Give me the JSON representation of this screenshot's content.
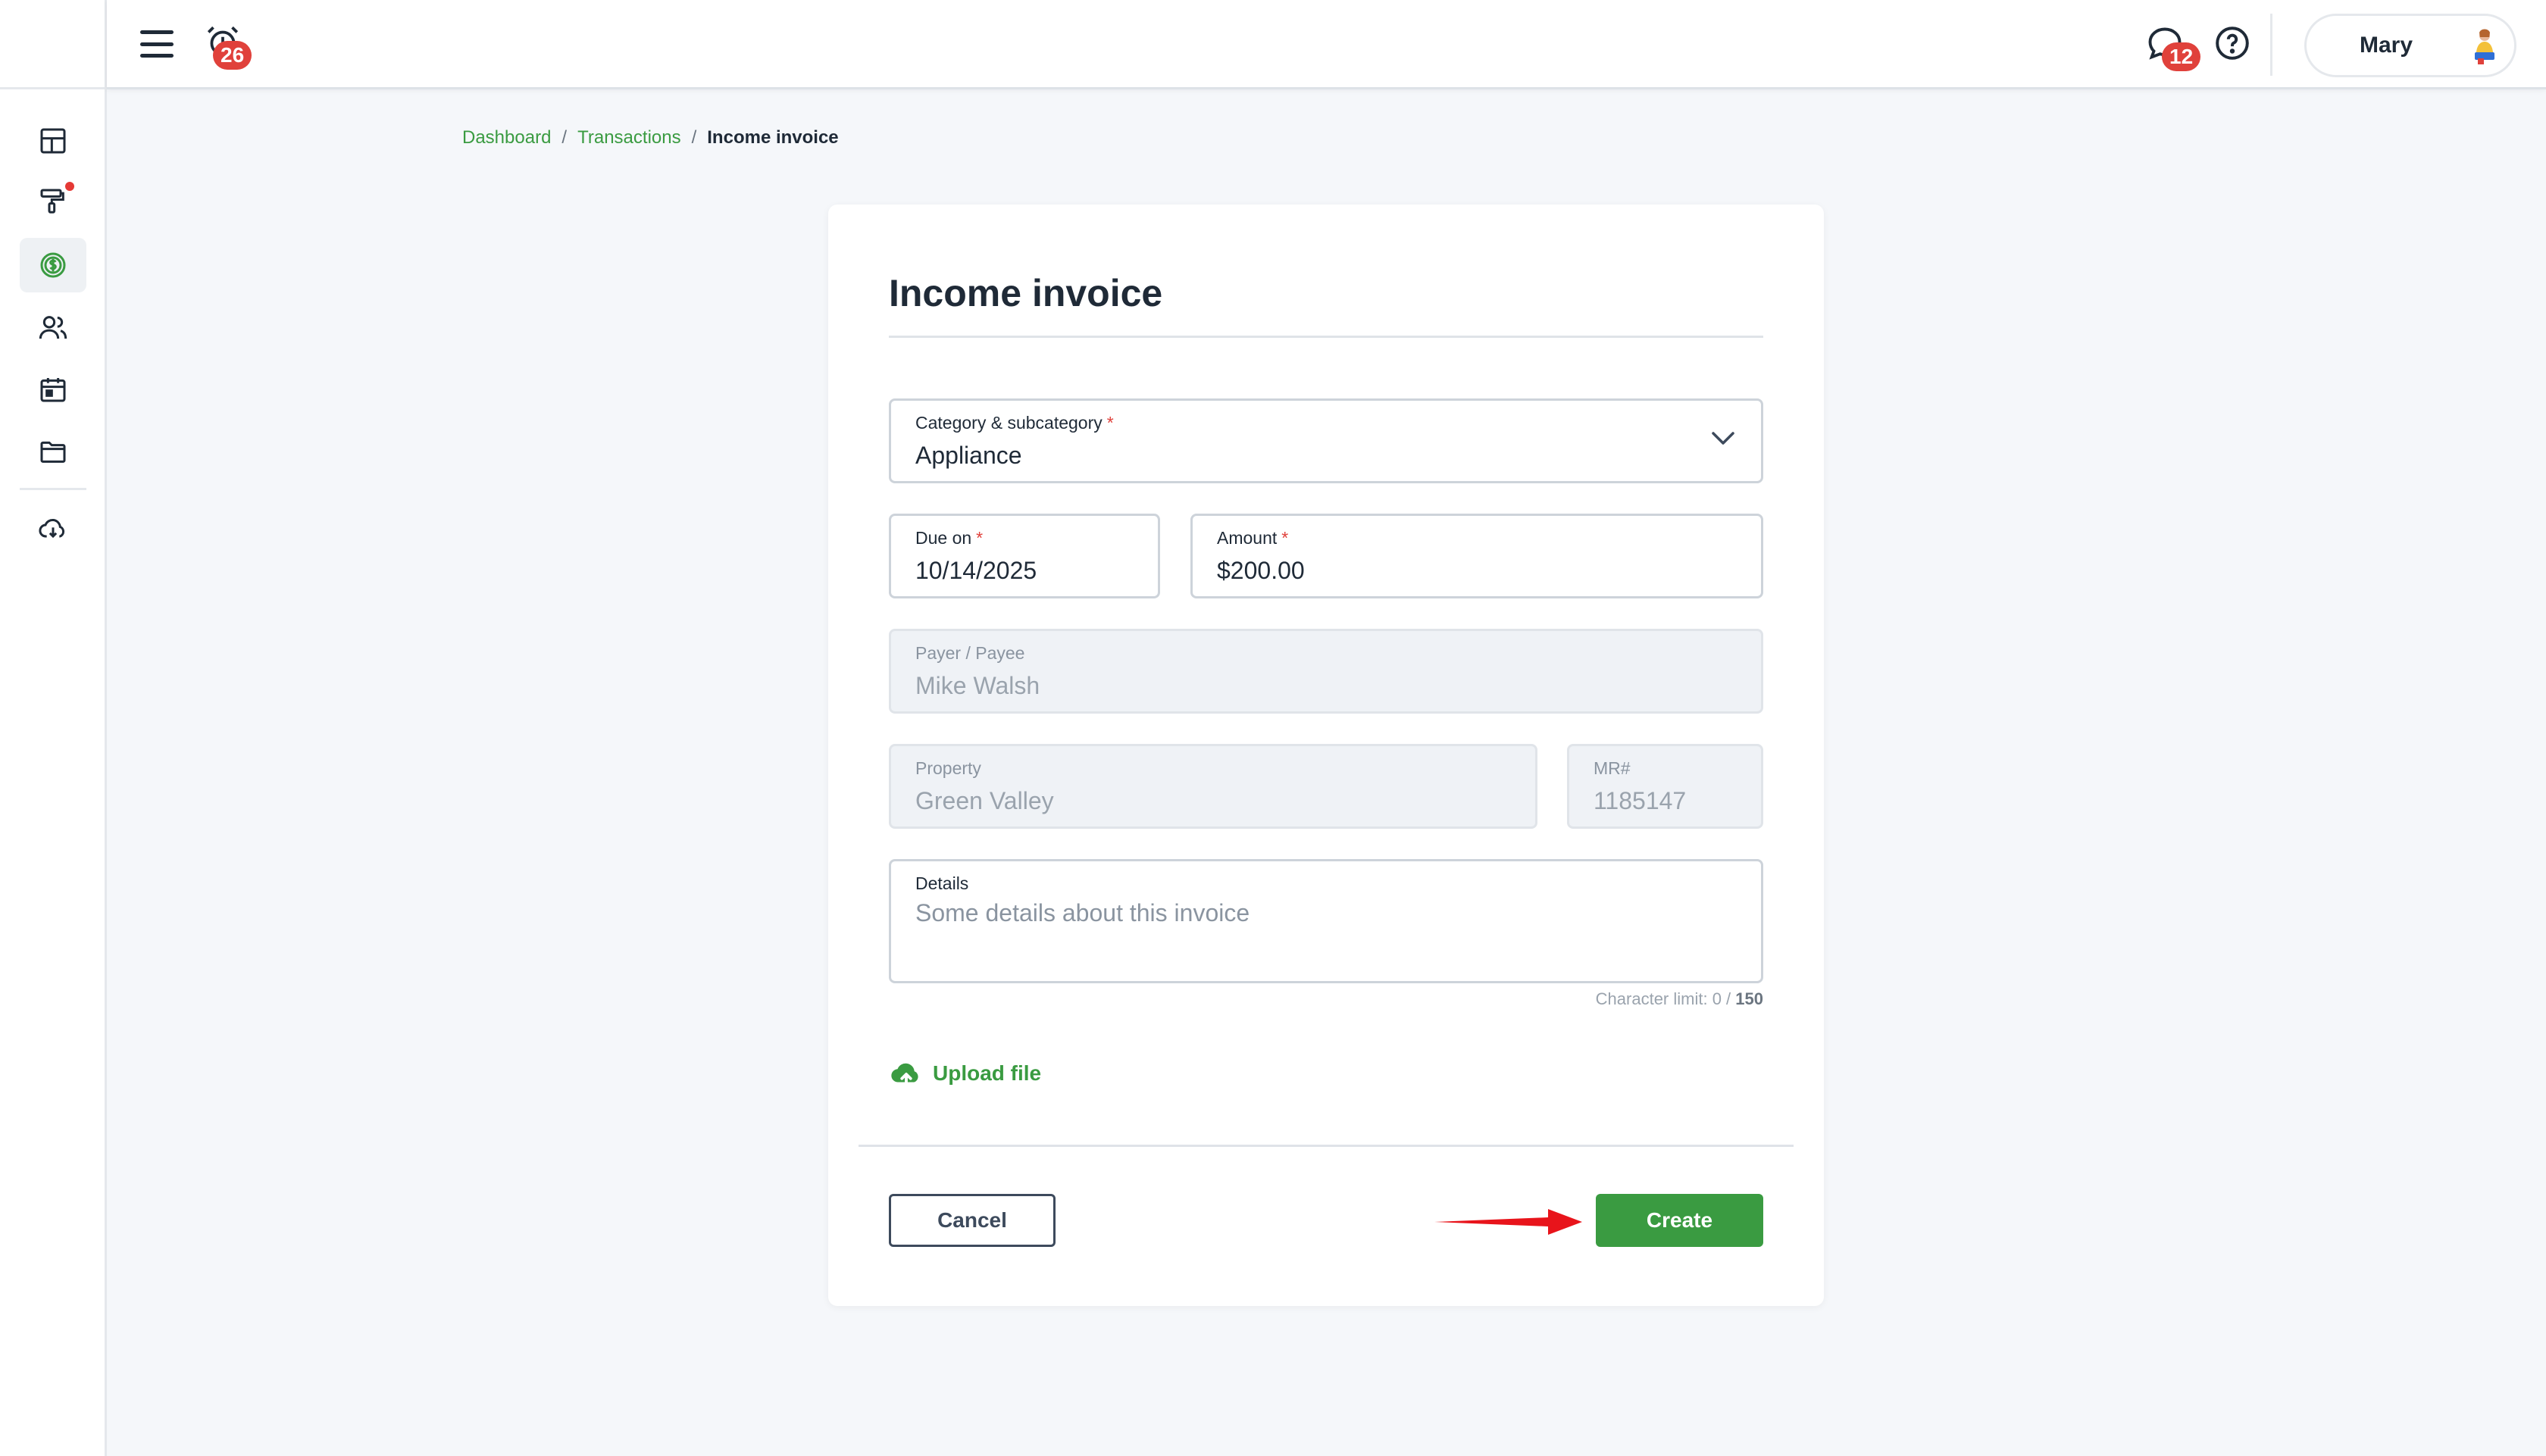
{
  "topbar": {
    "alarm_badge": "26",
    "chat_badge": "12",
    "user_name": "Mary"
  },
  "sidebar": {
    "items": [
      {
        "icon": "dashboard-grid-icon"
      },
      {
        "icon": "paint-roller-icon",
        "has_notification_dot": true
      },
      {
        "icon": "dollar-circle-icon",
        "active": true
      },
      {
        "icon": "people-icon"
      },
      {
        "icon": "calendar-icon"
      },
      {
        "icon": "folder-icon"
      },
      {
        "icon": "cloud-download-icon"
      }
    ]
  },
  "breadcrumb": {
    "items": [
      "Dashboard",
      "Transactions"
    ],
    "separator": "/",
    "current": "Income invoice"
  },
  "form": {
    "title": "Income invoice",
    "category": {
      "label": "Category & subcategory",
      "required_mark": "*",
      "value": "Appliance"
    },
    "due_on": {
      "label": "Due on",
      "required_mark": "*",
      "value": "10/14/2025"
    },
    "amount": {
      "label": "Amount",
      "required_mark": "*",
      "value": "$200.00"
    },
    "payer": {
      "label": "Payer / Payee",
      "value": "Mike Walsh"
    },
    "property": {
      "label": "Property",
      "value": "Green Valley"
    },
    "mr": {
      "label": "MR#",
      "value": "1185147"
    },
    "details": {
      "label": "Details",
      "placeholder": "Some details about this invoice"
    },
    "char_limit": {
      "prefix": "Character limit: 0 /",
      "max": "150"
    },
    "upload_label": "Upload file",
    "cancel_label": "Cancel",
    "create_label": "Create"
  },
  "colors": {
    "accent_green": "#3a9b41",
    "badge_red": "#e0413b",
    "annotation_arrow": "#e8141b"
  }
}
